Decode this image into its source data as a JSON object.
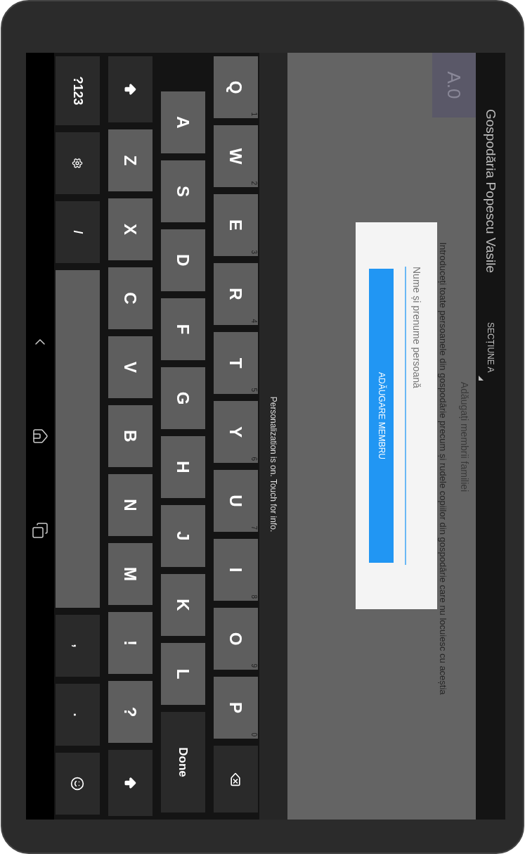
{
  "action_bar": {
    "title": "Gospodăria Popescu Vasile",
    "section_spinner": "SECȚIUNE A"
  },
  "section_badge": "A.0",
  "content": {
    "heading": "Adăugați membrii familiei",
    "description": "Introduceți toate persoanele din gospodărie precum și rudele copiilor din gospodărie care nu locuiesc cu aceștia"
  },
  "dialog": {
    "name_field": {
      "placeholder": "Nume și prenume persoană"
    },
    "button": "ADĂUGARE MEMBRU"
  },
  "keyboard": {
    "notice": "Personalization is on. Touch for info.",
    "key_lines": [
      {
        "keys": [
          {
            "kind": "letter",
            "label": "Q",
            "hint": "1"
          },
          {
            "kind": "letter",
            "label": "W",
            "hint": "2"
          },
          {
            "kind": "letter",
            "label": "E",
            "hint": "3"
          },
          {
            "kind": "letter",
            "label": "R",
            "hint": "4"
          },
          {
            "kind": "letter",
            "label": "T",
            "hint": "5"
          },
          {
            "kind": "letter",
            "label": "Y",
            "hint": "6"
          },
          {
            "kind": "letter",
            "label": "U",
            "hint": "7"
          },
          {
            "kind": "letter",
            "label": "I",
            "hint": "8"
          },
          {
            "kind": "letter",
            "label": "O",
            "hint": "9"
          },
          {
            "kind": "letter",
            "label": "P",
            "hint": "0"
          },
          {
            "kind": "backspace"
          }
        ]
      },
      {
        "keys": [
          {
            "kind": "letter",
            "label": "A"
          },
          {
            "kind": "letter",
            "label": "S"
          },
          {
            "kind": "letter",
            "label": "D"
          },
          {
            "kind": "letter",
            "label": "F"
          },
          {
            "kind": "letter",
            "label": "G"
          },
          {
            "kind": "letter",
            "label": "H"
          },
          {
            "kind": "letter",
            "label": "J"
          },
          {
            "kind": "letter",
            "label": "K"
          },
          {
            "kind": "letter",
            "label": "L"
          },
          {
            "kind": "enter",
            "label": "Done"
          }
        ]
      },
      {
        "keys": [
          {
            "kind": "shift"
          },
          {
            "kind": "letter",
            "label": "Z"
          },
          {
            "kind": "letter",
            "label": "X"
          },
          {
            "kind": "letter",
            "label": "C"
          },
          {
            "kind": "letter",
            "label": "V"
          },
          {
            "kind": "letter",
            "label": "B"
          },
          {
            "kind": "letter",
            "label": "N"
          },
          {
            "kind": "letter",
            "label": "M"
          },
          {
            "kind": "letter",
            "label": "!"
          },
          {
            "kind": "letter",
            "label": "?"
          },
          {
            "kind": "shift"
          }
        ]
      },
      {
        "keys": [
          {
            "kind": "symbols",
            "label": "?123"
          },
          {
            "kind": "settings"
          },
          {
            "kind": "punct",
            "label": "/"
          },
          {
            "kind": "space"
          },
          {
            "kind": "punct",
            "label": ","
          },
          {
            "kind": "punct",
            "label": "."
          },
          {
            "kind": "emoji"
          }
        ]
      }
    ]
  }
}
